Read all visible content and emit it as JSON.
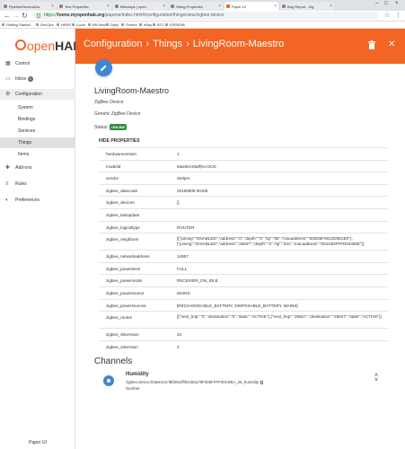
{
  "browser": {
    "tabs": [
      {
        "label": "PipelineSensorsDa"
      },
      {
        "label": "Text Properties"
      },
      {
        "label": "Bitemaps | open"
      },
      {
        "label": "String Properties"
      },
      {
        "label": "Paper UI"
      },
      {
        "label": "Bug Report - Zig"
      }
    ],
    "url_scheme": "https://",
    "url_host": "home.myopenhab.org",
    "url_path": "/paperui/index.html#/configuration/things/view/zigbee:device",
    "bookmarks": [
      "Getting Started",
      "DevOps",
      "HERE",
      "Local",
      "BN New",
      "Daily",
      "Screen",
      "eBay",
      "BTC",
      "ESP8266"
    ]
  },
  "sidebar": {
    "logo_open": "open",
    "logo_hab": "HAB",
    "items": [
      {
        "label": "Control",
        "icon": "grid-icon"
      },
      {
        "label": "Inbox",
        "badge": "0",
        "icon": "inbox-icon"
      },
      {
        "label": "Configuration",
        "icon": "gear-icon"
      },
      {
        "label": "System"
      },
      {
        "label": "Bindings"
      },
      {
        "label": "Services"
      },
      {
        "label": "Things"
      },
      {
        "label": "Items"
      },
      {
        "label": "Add-ons",
        "icon": "addons-icon"
      },
      {
        "label": "Rules",
        "icon": "rules-icon"
      },
      {
        "label": "Preferences",
        "icon": "preferences-icon"
      }
    ],
    "footer": "Paper UI"
  },
  "header": {
    "crumbs": [
      "Configuration",
      "Things",
      "LivingRoom-Maestro"
    ]
  },
  "thing": {
    "name": "LivingRoom-Maestro",
    "type": "ZigBee Device",
    "subtype": "Generic ZigBee Device",
    "status_label": "Status:",
    "status": "ONLINE",
    "hide_properties": "HIDE PROPERTIES"
  },
  "properties": [
    {
      "key": "hardwareversion",
      "value": "1"
    },
    {
      "key": "modelId",
      "value": "MaestroStat¶Kv.OOS"
    },
    {
      "key": "vendor",
      "value": "Stelpro"
    },
    {
      "key": "zigbee_datecode",
      "value": "20180509 00105"
    },
    {
      "key": "zigbee_devices",
      "value": "[]"
    },
    {
      "key": "zigbee_lastupdate",
      "value": ""
    },
    {
      "key": "zigbee_logicaltype",
      "value": "ROUTER"
    },
    {
      "key": "zigbee_neighbors",
      "value": "[{\"joining\":\"ENABLED\",\"address\":\"0\",\"depth\":\"0\",\"lqi\":\"55\",\"macaddress\":\"000D6F0012D0E2E0\"}, {\"joining\":\"DISABLED\",\"address\":\"26627\",\"depth\":\"2\",\"lqi\":\"231\",\"macaddress\":\"00244DFFFD034505\"}]"
    },
    {
      "key": "zigbee_networkaddress",
      "value": "14957"
    },
    {
      "key": "zigbee_powerlevel",
      "value": "FULL"
    },
    {
      "key": "zigbee_powermode",
      "value": "RECEIVER_ON_IDLE"
    },
    {
      "key": "zigbee_powersource",
      "value": "MAINS"
    },
    {
      "key": "zigbee_powersources",
      "value": "[RECHARGEABLE_BATTERY, DISPOSABLE_BATTERY, MAINS]"
    },
    {
      "key": "zigbee_routes",
      "value": "[{\"next_hop\":\"0\",\"destination\":\"0\",\"state\":\"ACTIVE\"},{\"next_hop\":\"26627\",\"destination\":\"26627\",\"state\":\"ACTIVE\"}]"
    },
    {
      "key": "zigbee_stkversion",
      "value": "24"
    },
    {
      "key": "zigbee_zdversion",
      "value": "2"
    }
  ],
  "channels": {
    "heading": "Channels",
    "items": [
      {
        "name": "Humidity",
        "uid": "zigbee:device:f2a8e1e3:f8f0051fff00cb6a:f8F005FFFF00CB6A_25_humidity",
        "type": "Number"
      }
    ]
  },
  "colors": {
    "accent": "#f26522",
    "fab": "#3f86d6",
    "online": "#2e8b3a"
  }
}
